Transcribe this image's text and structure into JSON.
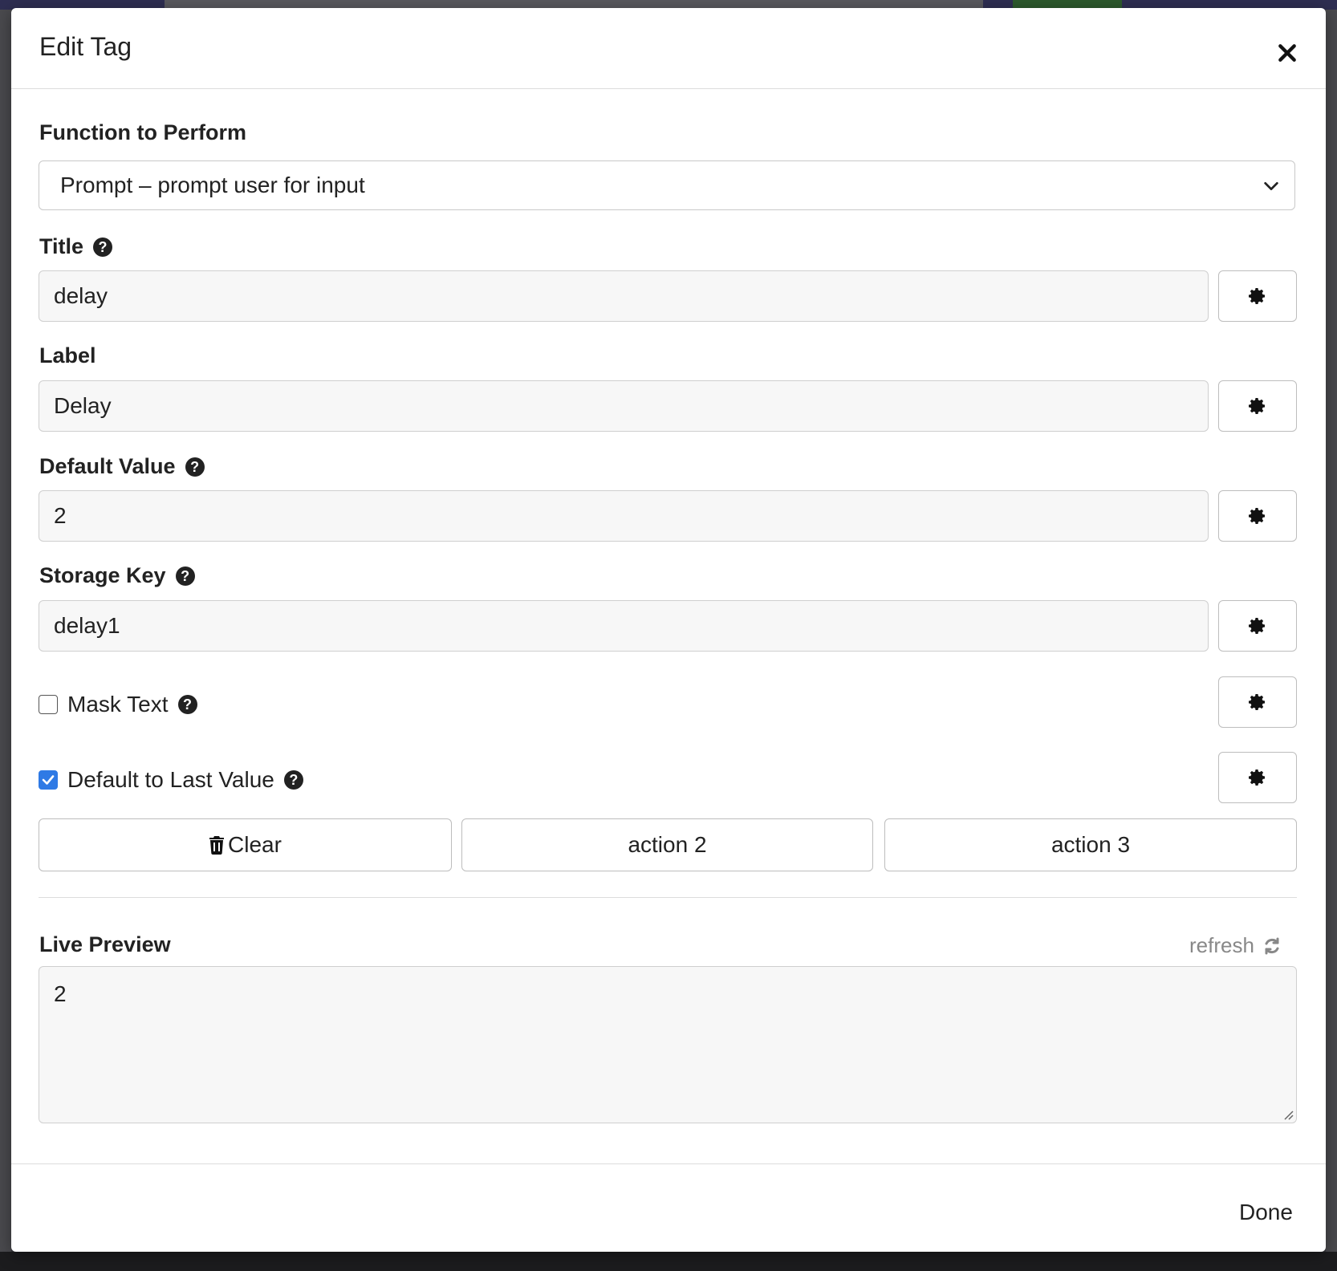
{
  "modal": {
    "title": "Edit Tag",
    "close_icon": "close-icon"
  },
  "function_field": {
    "label": "Function to Perform",
    "selected": "Prompt – prompt user for input"
  },
  "title_field": {
    "label": "Title",
    "value": "delay"
  },
  "label_field": {
    "label": "Label",
    "value": "Delay"
  },
  "default_value_field": {
    "label": "Default Value",
    "value": "2"
  },
  "storage_key_field": {
    "label": "Storage Key",
    "value": "delay1"
  },
  "mask_text": {
    "label": "Mask Text",
    "checked": false
  },
  "default_to_last": {
    "label": "Default to Last Value",
    "checked": true
  },
  "actions": {
    "clear_label": "Clear",
    "action2_label": "action 2",
    "action3_label": "action 3"
  },
  "live_preview": {
    "label": "Live Preview",
    "refresh_label": "refresh",
    "value": "2"
  },
  "footer": {
    "done_label": "Done"
  },
  "colors": {
    "accent": "#2f7ae5"
  }
}
